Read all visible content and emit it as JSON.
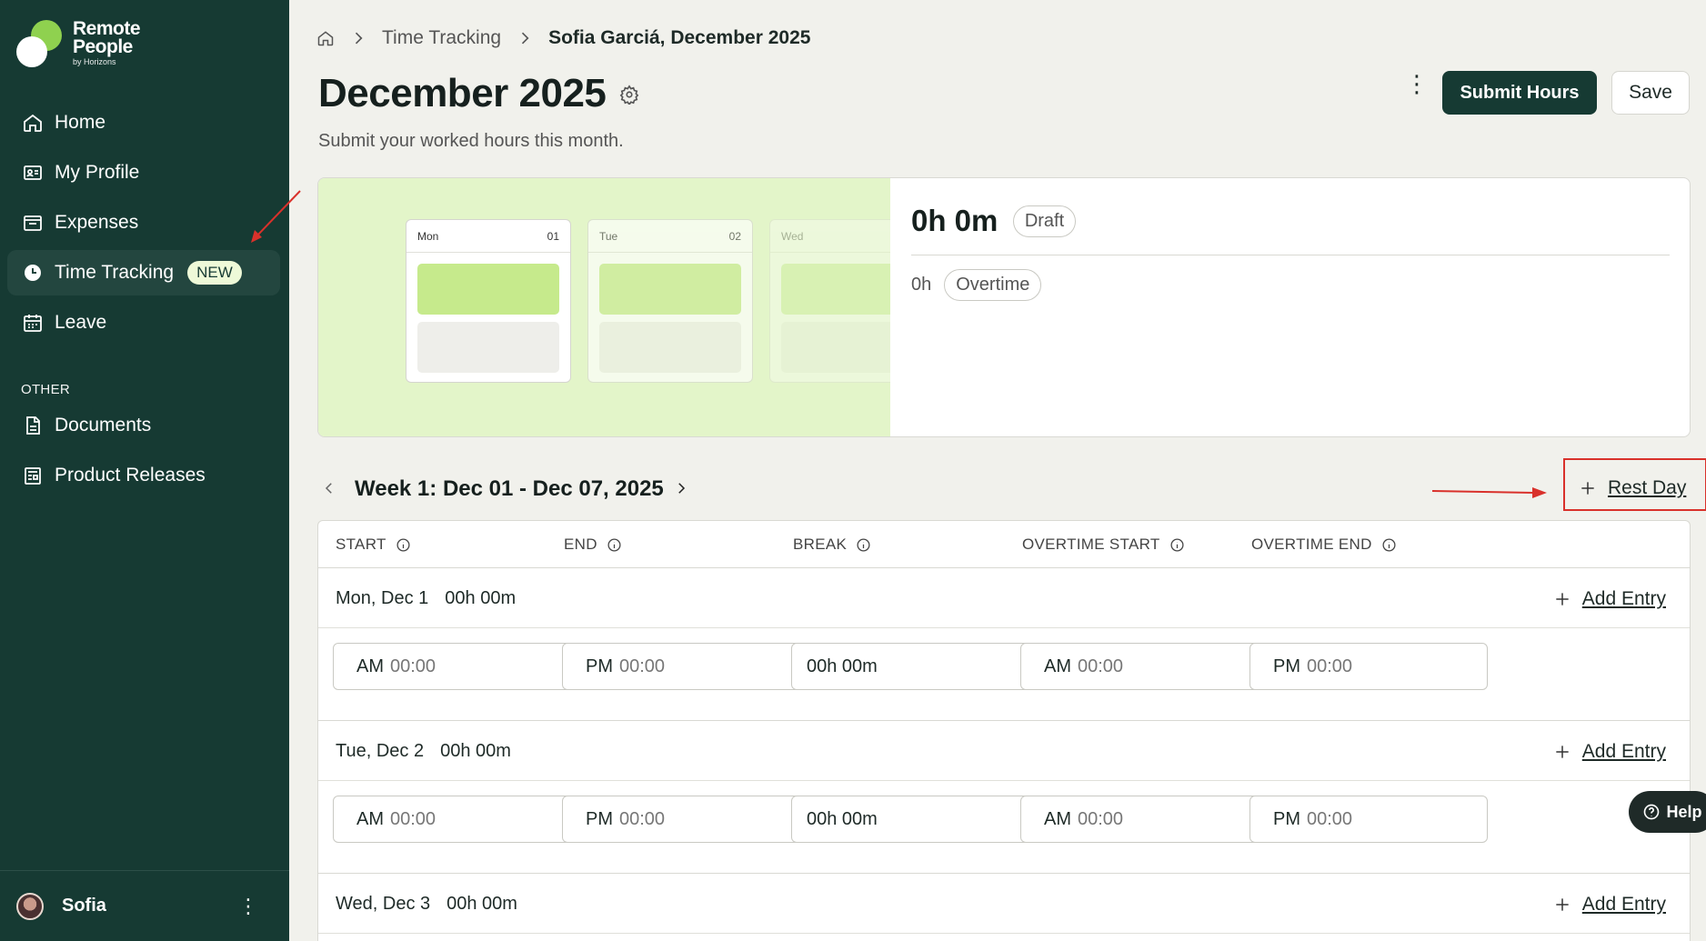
{
  "brand": {
    "line1": "Remote",
    "line2": "People",
    "line3": "by Horizons"
  },
  "sidebar": {
    "items": [
      {
        "label": "Home",
        "icon": "home-icon"
      },
      {
        "label": "My Profile",
        "icon": "id-card-icon"
      },
      {
        "label": "Expenses",
        "icon": "wallet-icon"
      },
      {
        "label": "Time Tracking",
        "icon": "clock-icon",
        "badge": "NEW",
        "active": true
      },
      {
        "label": "Leave",
        "icon": "calendar-icon"
      }
    ],
    "section_label": "OTHER",
    "other_items": [
      {
        "label": "Documents",
        "icon": "document-icon"
      },
      {
        "label": "Product Releases",
        "icon": "newspaper-icon"
      }
    ],
    "user_name": "Sofia"
  },
  "breadcrumb": {
    "section": "Time Tracking",
    "current": "Sofia Garciá, December 2025"
  },
  "header": {
    "title": "December 2025",
    "subtitle": "Submit your worked hours this month.",
    "submit_label": "Submit Hours",
    "save_label": "Save"
  },
  "summary": {
    "total": "0h 0m",
    "status": "Draft",
    "overtime_value": "0h",
    "overtime_label": "Overtime",
    "illustration_days": [
      {
        "day": "Mon",
        "num": "01"
      },
      {
        "day": "Tue",
        "num": "02"
      },
      {
        "day": "Wed",
        "num": ""
      }
    ]
  },
  "week": {
    "title": "Week 1: Dec 01 - Dec 07, 2025",
    "rest_day_label": "Rest Day"
  },
  "table": {
    "columns": [
      "START",
      "END",
      "BREAK",
      "OVERTIME START",
      "OVERTIME END"
    ],
    "add_entry_label": "Add Entry",
    "days": [
      {
        "label": "Mon, Dec 1",
        "total": "00h 00m"
      },
      {
        "label": "Tue, Dec 2",
        "total": "00h 00m"
      },
      {
        "label": "Wed, Dec 3",
        "total": "00h 00m"
      }
    ],
    "inputs": {
      "start_ampm": "AM",
      "end_ampm": "PM",
      "ot_start_ampm": "AM",
      "ot_end_ampm": "PM",
      "time_placeholder": "00:00",
      "break_value": "00h 00m"
    }
  },
  "help_label": "Help",
  "colors": {
    "sidebar_bg": "#163a33",
    "accent_green": "#8fd14f",
    "annotation_red": "#d9312b"
  }
}
